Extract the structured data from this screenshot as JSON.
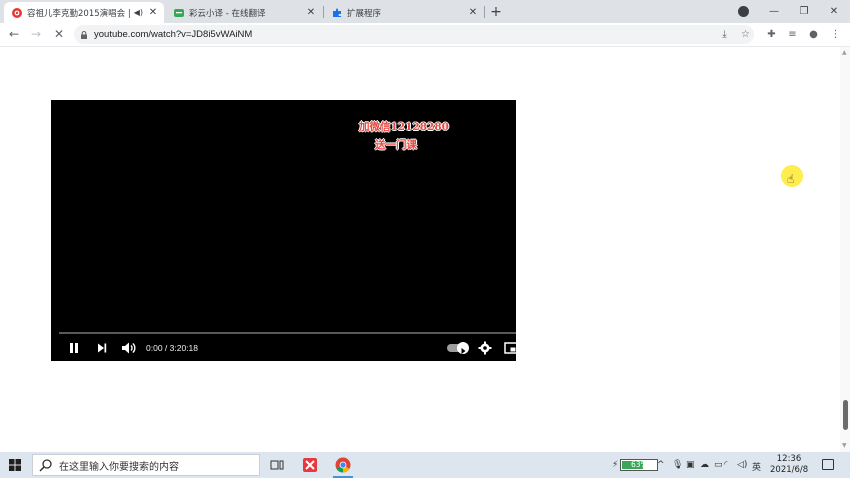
{
  "browser": {
    "tabs": [
      {
        "title": "容祖儿李克勤2015演唱会 |",
        "active": true,
        "audio": true
      },
      {
        "title": "彩云小译 - 在线翻译",
        "active": false
      },
      {
        "title": "扩展程序",
        "active": false
      }
    ],
    "url": "youtube.com/watch?v=JD8i5vWAiNM"
  },
  "player": {
    "watermark_line1": "加微信12128280",
    "watermark_line2": "送一门课",
    "time": "0:00 / 3:20:18",
    "progress": 0.0,
    "state": "playing"
  },
  "taskbar": {
    "search_placeholder": "在这里输入你要搜索的内容",
    "battery": "63%",
    "battery_level": 0.63,
    "ime": "英",
    "clock_time": "12:36",
    "clock_date": "2021/6/8"
  },
  "colors": {
    "tabstrip": "#dee1e6",
    "taskbar": "#dde6ee",
    "watermark": "#e8483f",
    "cursor_highlight": "#ffeb3b"
  }
}
